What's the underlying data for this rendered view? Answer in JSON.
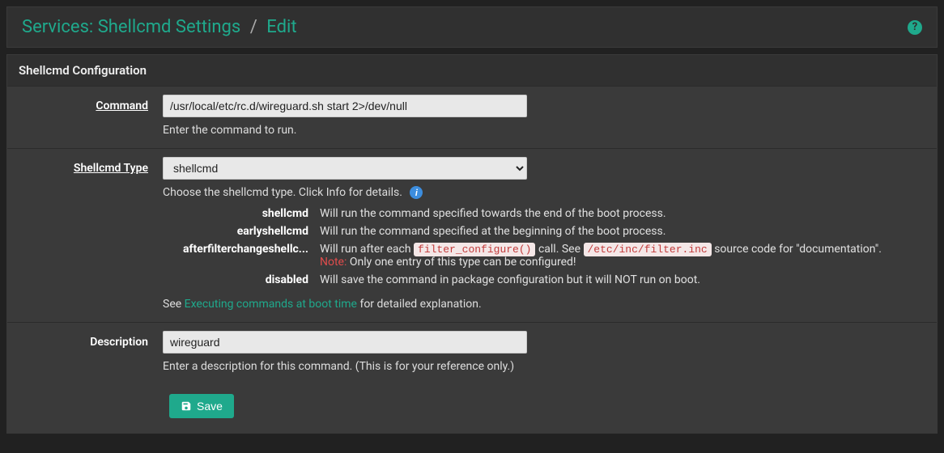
{
  "header": {
    "title_main": "Services: Shellcmd Settings",
    "separator": "/",
    "title_sub": "Edit"
  },
  "panel": {
    "heading": "Shellcmd Configuration"
  },
  "fields": {
    "command": {
      "label": "Command",
      "value": "/usr/local/etc/rc.d/wireguard.sh start 2>/dev/null",
      "help": "Enter the command to run."
    },
    "type": {
      "label": "Shellcmd Type",
      "selected": "shellcmd",
      "help": "Choose the shellcmd type. Click Info for details.",
      "defs": {
        "shellcmd": {
          "term": "shellcmd",
          "desc": "Will run the command specified towards the end of the boot process."
        },
        "earlyshellcmd": {
          "term": "earlyshellcmd",
          "desc": "Will run the command specified at the beginning of the boot process."
        },
        "afterfilter": {
          "term": "afterfilterchangeshellc...",
          "pre": "Will run after each ",
          "code1": "filter_configure()",
          "mid": " call. See ",
          "code2": "/etc/inc/filter.inc",
          "post": " source code for \"documentation\".",
          "note_label": "Note:",
          "note_text": " Only one entry of this type can be configured!"
        },
        "disabled": {
          "term": "disabled",
          "desc": "Will save the command in package configuration but it will NOT run on boot."
        }
      },
      "see_pre": "See ",
      "see_link": "Executing commands at boot time",
      "see_post": " for detailed explanation."
    },
    "description": {
      "label": "Description",
      "value": "wireguard",
      "help": "Enter a description for this command. (This is for your reference only.)"
    }
  },
  "buttons": {
    "save": "Save"
  }
}
